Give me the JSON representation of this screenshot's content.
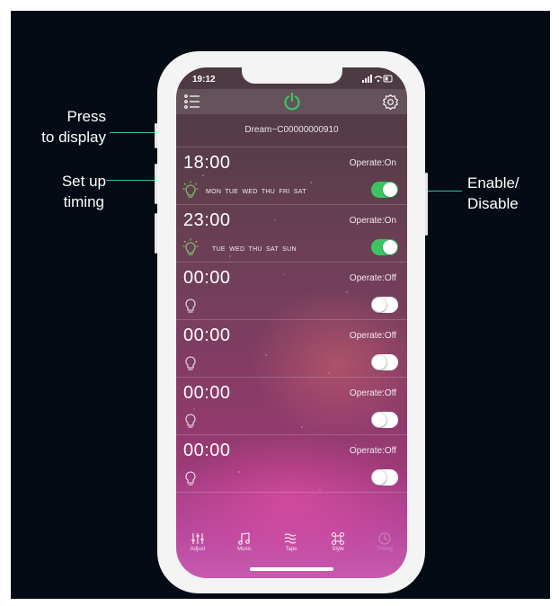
{
  "callouts": {
    "press_line1": "Press",
    "press_line2": "to display",
    "setup_line1": "Set up",
    "setup_line2": "timing",
    "enable_line1": "Enable/",
    "enable_line2": "Disable"
  },
  "status_bar": {
    "time": "19:12",
    "icons": "signal wifi battery"
  },
  "header": {
    "menu_icon": "list-icon",
    "power_icon": "power-icon",
    "settings_icon": "gear-icon",
    "accent": "#3cc463"
  },
  "device": {
    "name": "Dream~C00000000910"
  },
  "timers": [
    {
      "time": "18:00",
      "operate": "Operate:On",
      "days": "MON  TUE  WED  THU  FRI  SAT",
      "enabled": true,
      "bulb": "lit"
    },
    {
      "time": "23:00",
      "operate": "Operate:On",
      "days": "TUE  WED  THU  SAT  SUN",
      "enabled": true,
      "bulb": "lit"
    },
    {
      "time": "00:00",
      "operate": "Operate:Off",
      "days": "",
      "enabled": false,
      "bulb": "unlit"
    },
    {
      "time": "00:00",
      "operate": "Operate:Off",
      "days": "",
      "enabled": false,
      "bulb": "unlit"
    },
    {
      "time": "00:00",
      "operate": "Operate:Off",
      "days": "",
      "enabled": false,
      "bulb": "unlit"
    },
    {
      "time": "00:00",
      "operate": "Operate:Off",
      "days": "",
      "enabled": false,
      "bulb": "unlit"
    }
  ],
  "tabs": [
    {
      "label": "Adjust",
      "icon": "sliders-icon"
    },
    {
      "label": "Music",
      "icon": "music-note-icon"
    },
    {
      "label": "Tape",
      "icon": "waves-icon"
    },
    {
      "label": "Style",
      "icon": "command-icon"
    },
    {
      "label": "Timing",
      "icon": "clock-icon"
    }
  ]
}
